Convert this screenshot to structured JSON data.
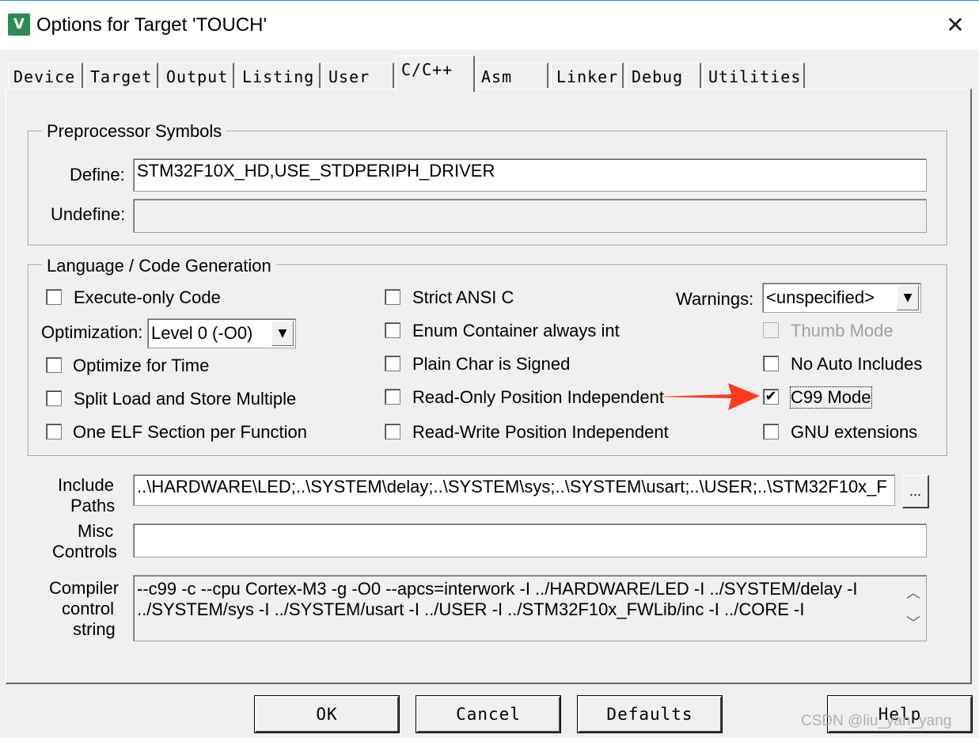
{
  "window": {
    "title": "Options for Target 'TOUCH'",
    "icon_text": "V",
    "close_glyph": "✕"
  },
  "tabs": [
    {
      "label": "Device"
    },
    {
      "label": "Target"
    },
    {
      "label": "Output"
    },
    {
      "label": "Listing"
    },
    {
      "label": "User"
    },
    {
      "label": "C/C++",
      "active": true
    },
    {
      "label": "Asm"
    },
    {
      "label": "Linker"
    },
    {
      "label": "Debug"
    },
    {
      "label": "Utilities"
    }
  ],
  "preprocessor": {
    "group_title": "Preprocessor Symbols",
    "define_label": "Define:",
    "define_value": "STM32F10X_HD,USE_STDPERIPH_DRIVER",
    "undefine_label": "Undefine:",
    "undefine_value": ""
  },
  "language": {
    "group_title": "Language / Code Generation",
    "execute_only": {
      "label": "Execute-only Code",
      "checked": false
    },
    "optimization": {
      "label": "Optimization:",
      "value": "Level 0 (-O0)"
    },
    "optimize_time": {
      "label": "Optimize for Time",
      "checked": false
    },
    "split_load": {
      "label": "Split Load and Store Multiple",
      "checked": false
    },
    "one_elf": {
      "label": "One ELF Section per Function",
      "checked": false
    },
    "strict_ansi": {
      "label": "Strict ANSI C",
      "checked": false
    },
    "enum_container": {
      "label": "Enum Container always int",
      "checked": false
    },
    "plain_char": {
      "label": "Plain Char is Signed",
      "checked": false
    },
    "ropi": {
      "label": "Read-Only Position Independent",
      "checked": false
    },
    "rwpi": {
      "label": "Read-Write Position Independent",
      "checked": false
    },
    "warnings": {
      "label": "Warnings:",
      "value": "<unspecified>"
    },
    "thumb_mode": {
      "label": "Thumb Mode",
      "checked": false,
      "disabled": true
    },
    "no_auto_includes": {
      "label": "No Auto Includes",
      "checked": false
    },
    "c99_mode": {
      "label": "C99 Mode",
      "checked": true
    },
    "gnu_extensions": {
      "label": "GNU extensions",
      "checked": false
    }
  },
  "include_paths": {
    "label_line1": "Include",
    "label_line2": "Paths",
    "value": "..\\HARDWARE\\LED;..\\SYSTEM\\delay;..\\SYSTEM\\sys;..\\SYSTEM\\usart;..\\USER;..\\STM32F10x_F",
    "browse_label": "..."
  },
  "misc_controls": {
    "label_line1": "Misc",
    "label_line2": "Controls",
    "value": ""
  },
  "compiler_control": {
    "label_line1": "Compiler",
    "label_line2": "control",
    "label_line3": "string",
    "line1": "--c99 -c --cpu Cortex-M3 -g -O0 --apcs=interwork -I ../HARDWARE/LED -I ../SYSTEM/delay -I",
    "line2": "../SYSTEM/sys -I ../SYSTEM/usart -I ../USER -I ../STM32F10x_FWLib/inc -I ../CORE -I",
    "scroll_up": "︿",
    "scroll_down": "﹀"
  },
  "buttons": {
    "ok": "OK",
    "cancel": "Cancel",
    "defaults": "Defaults",
    "help": "Help"
  },
  "annotation": {
    "arrow_color": "#ff3b1f"
  },
  "watermark": "CSDN @liu_yan_yang"
}
